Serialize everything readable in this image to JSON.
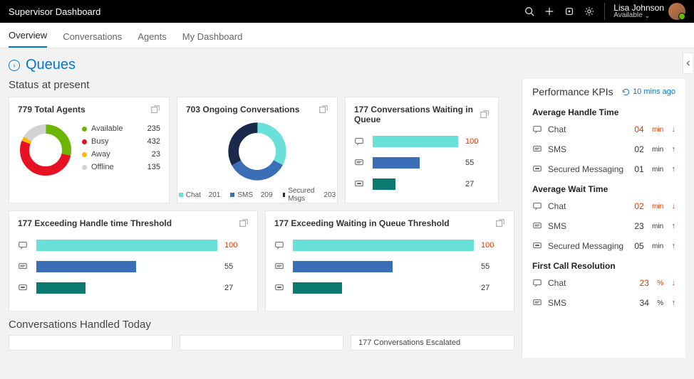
{
  "header": {
    "title": "Supervisor Dashboard",
    "user_name": "Lisa Johnson",
    "user_status": "Available"
  },
  "tabs": [
    "Overview",
    "Conversations",
    "Agents",
    "My Dashboard"
  ],
  "page_title": "Queues",
  "status_heading": "Status at present",
  "cards": {
    "agents": {
      "title": "779  Total Agents",
      "items": [
        {
          "label": "Available",
          "value": "235",
          "color": "#6bb700"
        },
        {
          "label": "Busy",
          "value": "432",
          "color": "#e81123"
        },
        {
          "label": "Away",
          "value": "23",
          "color": "#ffb900"
        },
        {
          "label": "Offline",
          "value": "135",
          "color": "#d2d2d2"
        }
      ]
    },
    "ongoing": {
      "title": "703 Ongoing Conversations",
      "items": [
        {
          "label": "Chat",
          "value": "201",
          "color": "#69e0d8"
        },
        {
          "label": "SMS",
          "value": "209",
          "color": "#3a6fb7"
        },
        {
          "label": "Secured Msgs",
          "value": "203",
          "color": "#1a2a4a"
        }
      ]
    },
    "waiting": {
      "title": "177 Conversations Waiting in Queue",
      "rows": [
        {
          "icon": "chat",
          "value": "100",
          "pct": 100,
          "color": "#69e0d8",
          "red": true
        },
        {
          "icon": "sms",
          "value": "55",
          "pct": 55,
          "color": "#3a6fb7",
          "red": false
        },
        {
          "icon": "msg",
          "value": "27",
          "pct": 27,
          "color": "#0d7a72",
          "red": false
        }
      ]
    },
    "exceed_handle": {
      "title": "177  Exceeding Handle time Threshold",
      "rows": [
        {
          "icon": "chat",
          "value": "100",
          "pct": 100,
          "color": "#69e0d8",
          "red": true
        },
        {
          "icon": "sms",
          "value": "55",
          "pct": 55,
          "color": "#3a6fb7",
          "red": false
        },
        {
          "icon": "msg",
          "value": "27",
          "pct": 27,
          "color": "#0d7a72",
          "red": false
        }
      ]
    },
    "exceed_wait": {
      "title": "177   Exceeding Waiting in Queue Threshold",
      "rows": [
        {
          "icon": "chat",
          "value": "100",
          "pct": 100,
          "color": "#69e0d8",
          "red": true
        },
        {
          "icon": "sms",
          "value": "55",
          "pct": 55,
          "color": "#3a6fb7",
          "red": false
        },
        {
          "icon": "msg",
          "value": "27",
          "pct": 27,
          "color": "#0d7a72",
          "red": false
        }
      ]
    }
  },
  "handled_today_heading": "Conversations Handled Today",
  "peek": [
    "",
    "",
    "177 Conversations Escalated"
  ],
  "kpi": {
    "title": "Performance KPIs",
    "ago": "10 mins ago",
    "groups": [
      {
        "title": "Average Handle Time",
        "lines": [
          {
            "icon": "chat",
            "label": "Chat",
            "value": "04",
            "unit": "min",
            "trend": "down",
            "red": true
          },
          {
            "icon": "sms",
            "label": "SMS",
            "value": "02",
            "unit": "min",
            "trend": "up",
            "red": false
          },
          {
            "icon": "msg",
            "label": "Secured Messaging",
            "value": "01",
            "unit": "min",
            "trend": "up",
            "red": false
          }
        ]
      },
      {
        "title": "Average Wait Time",
        "lines": [
          {
            "icon": "chat",
            "label": "Chat",
            "value": "02",
            "unit": "min",
            "trend": "down",
            "red": true
          },
          {
            "icon": "sms",
            "label": "SMS",
            "value": "23",
            "unit": "min",
            "trend": "up",
            "red": false
          },
          {
            "icon": "msg",
            "label": "Secured Messaging",
            "value": "05",
            "unit": "min",
            "trend": "up",
            "red": false
          }
        ]
      },
      {
        "title": "First Call Resolution",
        "lines": [
          {
            "icon": "chat",
            "label": "Chat",
            "value": "23",
            "unit": "%",
            "trend": "down",
            "red": true
          },
          {
            "icon": "sms",
            "label": "SMS",
            "value": "34",
            "unit": "%",
            "trend": "up",
            "red": false
          }
        ]
      }
    ]
  },
  "chart_data": [
    {
      "type": "pie",
      "title": "779 Total Agents",
      "series": [
        {
          "name": "Available",
          "value": 235,
          "color": "#6bb700"
        },
        {
          "name": "Busy",
          "value": 432,
          "color": "#e81123"
        },
        {
          "name": "Away",
          "value": 23,
          "color": "#ffb900"
        },
        {
          "name": "Offline",
          "value": 135,
          "color": "#d2d2d2"
        }
      ]
    },
    {
      "type": "pie",
      "title": "703 Ongoing Conversations",
      "series": [
        {
          "name": "Chat",
          "value": 201,
          "color": "#69e0d8"
        },
        {
          "name": "SMS",
          "value": 209,
          "color": "#3a6fb7"
        },
        {
          "name": "Secured Msgs",
          "value": 203,
          "color": "#1a2a4a"
        }
      ]
    },
    {
      "type": "bar",
      "title": "177 Conversations Waiting in Queue",
      "categories": [
        "Chat",
        "SMS",
        "Secured Messaging"
      ],
      "values": [
        100,
        55,
        27
      ]
    },
    {
      "type": "bar",
      "title": "177 Exceeding Handle time Threshold",
      "categories": [
        "Chat",
        "SMS",
        "Secured Messaging"
      ],
      "values": [
        100,
        55,
        27
      ]
    },
    {
      "type": "bar",
      "title": "177 Exceeding Waiting in Queue Threshold",
      "categories": [
        "Chat",
        "SMS",
        "Secured Messaging"
      ],
      "values": [
        100,
        55,
        27
      ]
    }
  ]
}
